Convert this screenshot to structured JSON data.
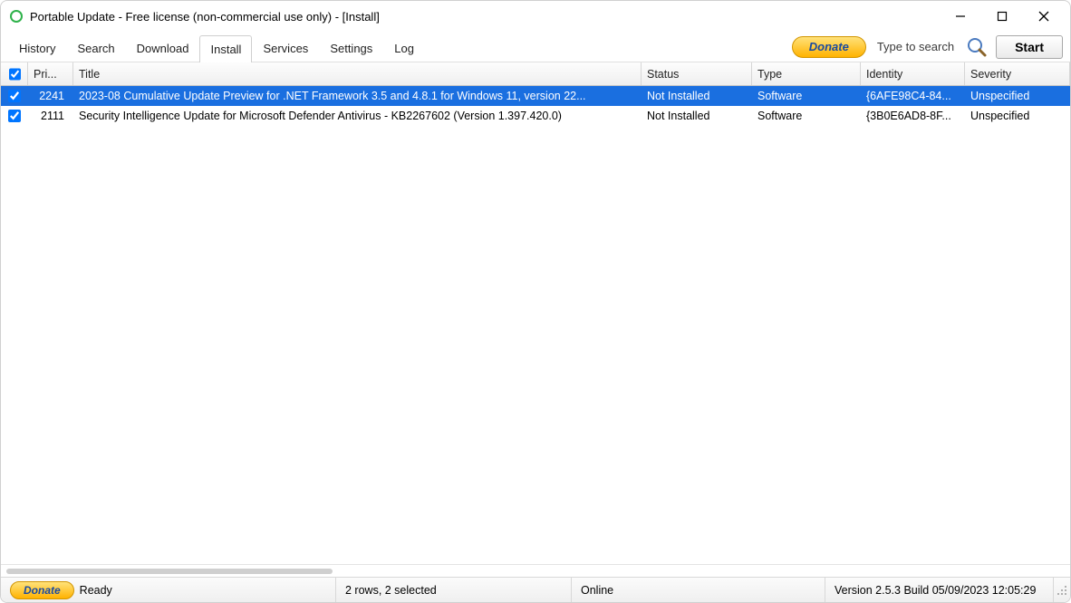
{
  "window": {
    "title": "Portable Update  - Free license (non-commercial use only) - [Install]"
  },
  "tabs": {
    "items": [
      {
        "label": "History",
        "active": false
      },
      {
        "label": "Search",
        "active": false
      },
      {
        "label": "Download",
        "active": false
      },
      {
        "label": "Install",
        "active": true
      },
      {
        "label": "Services",
        "active": false
      },
      {
        "label": "Settings",
        "active": false
      },
      {
        "label": "Log",
        "active": false
      }
    ]
  },
  "toolbar": {
    "donate_label": "Donate",
    "search_placeholder": "Type to search",
    "start_label": "Start"
  },
  "columns": {
    "pri": "Pri...",
    "title": "Title",
    "status": "Status",
    "type": "Type",
    "identity": "Identity",
    "severity": "Severity"
  },
  "rows": [
    {
      "checked": true,
      "priority": "2241",
      "title": "2023-08 Cumulative Update Preview for .NET Framework 3.5 and 4.8.1 for Windows 11, version 22...",
      "status": "Not Installed",
      "type": "Software",
      "identity": "{6AFE98C4-84...",
      "severity": "Unspecified",
      "selected": true
    },
    {
      "checked": true,
      "priority": "2111",
      "title": "Security Intelligence Update for Microsoft Defender Antivirus - KB2267602 (Version 1.397.420.0)",
      "status": "Not Installed",
      "type": "Software",
      "identity": "{3B0E6AD8-8F...",
      "severity": "Unspecified",
      "selected": false
    }
  ],
  "statusbar": {
    "donate_label": "Donate",
    "state": "Ready",
    "summary": "2 rows, 2 selected",
    "connection": "Online",
    "version": "Version 2.5.3 Build 05/09/2023 12:05:29"
  }
}
